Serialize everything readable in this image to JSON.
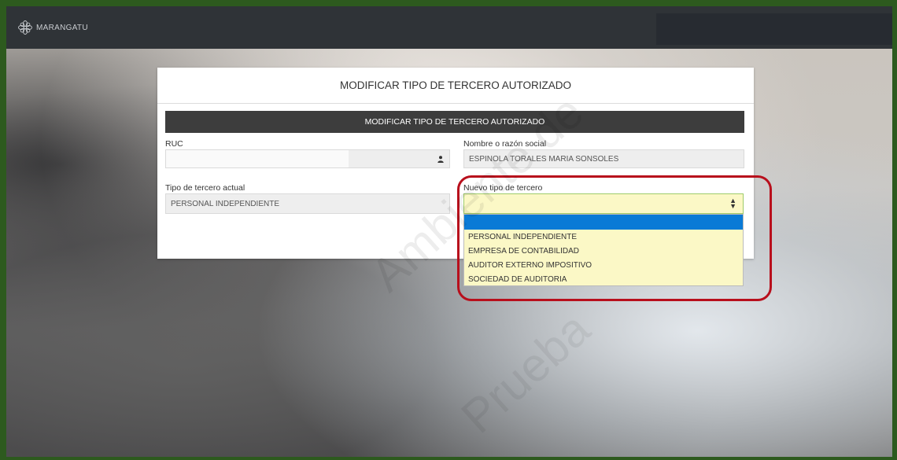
{
  "app": {
    "brand": "MARANGATU"
  },
  "form": {
    "title": "MODIFICAR TIPO DE TERCERO AUTORIZADO",
    "section_title": "MODIFICAR TIPO DE TERCERO AUTORIZADO",
    "ruc": {
      "label": "RUC",
      "value": ""
    },
    "nombre": {
      "label": "Nombre o razón social",
      "value": "ESPINOLA TORALES MARIA SONSOLES"
    },
    "tipo_actual": {
      "label": "Tipo de tercero actual",
      "value": "PERSONAL INDEPENDIENTE"
    },
    "nuevo_tipo": {
      "label": "Nuevo tipo de tercero",
      "value": "",
      "options": [
        "",
        "PERSONAL INDEPENDIENTE",
        "EMPRESA DE CONTABILIDAD",
        "AUDITOR EXTERNO IMPOSITIVO",
        "SOCIEDAD DE AUDITORIA"
      ]
    }
  },
  "watermark": {
    "line1": "Ambiente de",
    "line2": "Prueba"
  },
  "colors": {
    "topbar": "#2f3337",
    "section_bar": "#3d3d3d",
    "selected_option": "#0a7ad6",
    "highlight": "#b80f1c",
    "frame": "#2d5a1e"
  },
  "icons": {
    "brand_logo": "flower-logo-icon",
    "ruc_addon": "user-icon",
    "select_arrow": "sort-arrows-icon"
  }
}
